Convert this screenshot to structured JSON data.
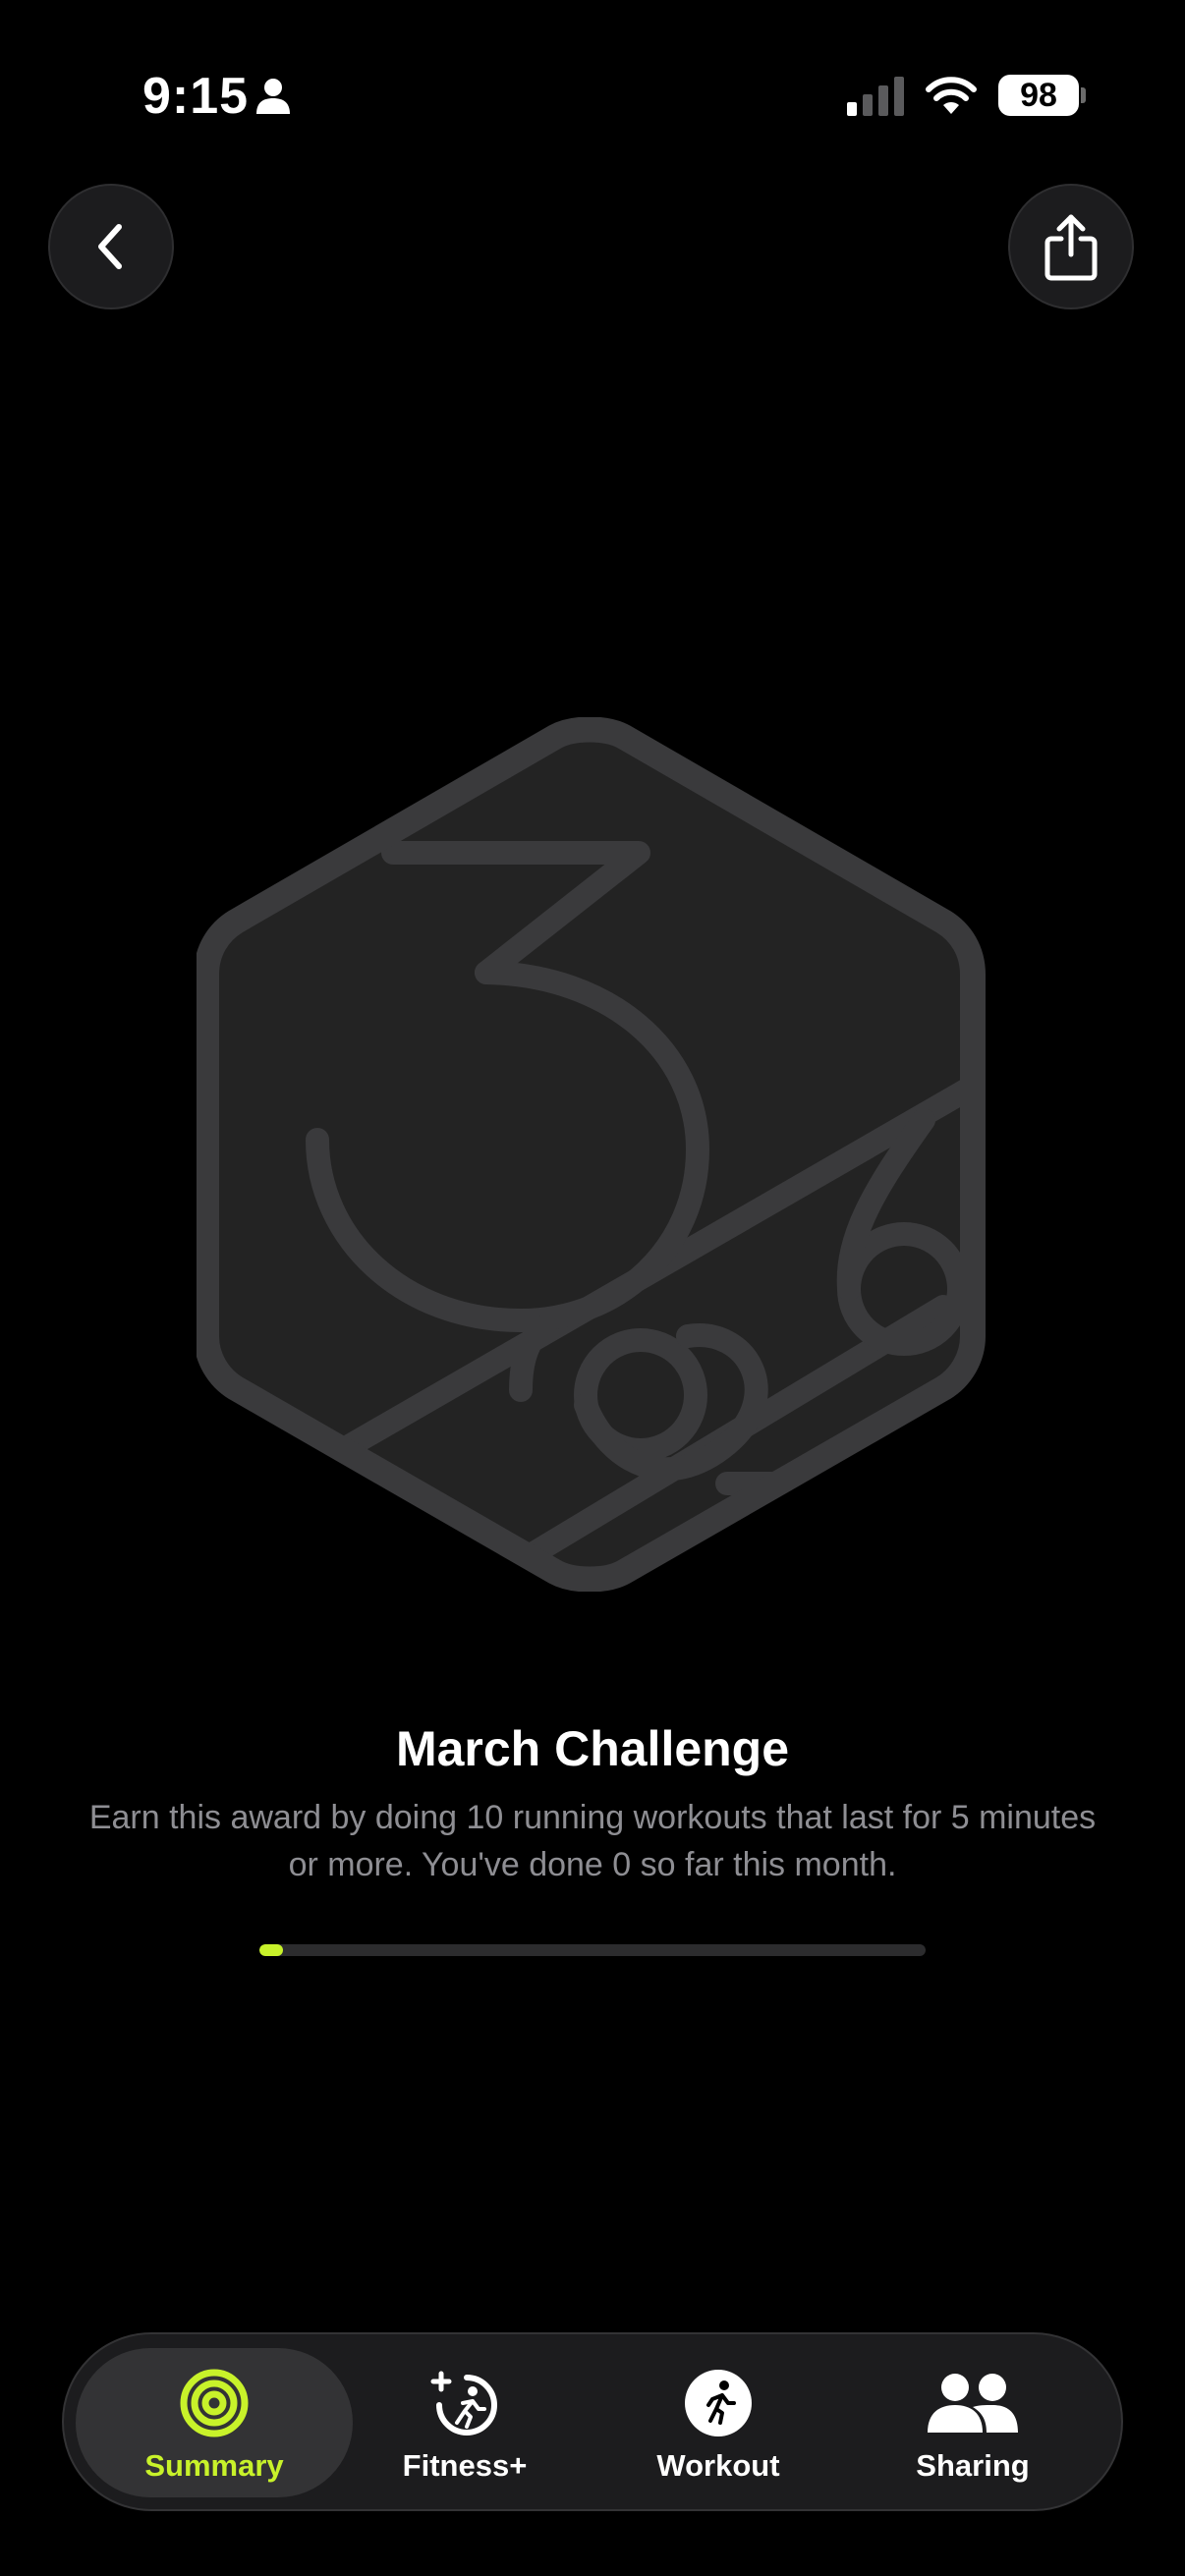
{
  "status_bar": {
    "time": "9:15",
    "battery": "98",
    "icons": [
      "person-icon",
      "cellular-signal-icon",
      "wifi-icon",
      "battery-icon"
    ]
  },
  "header": {
    "back_icon": "chevron-left-icon",
    "share_icon": "share-icon"
  },
  "award": {
    "badge_icon": "march-2026-hexagon-badge",
    "title": "March Challenge",
    "description": "Earn this award by doing 10 running workouts that last for 5 minutes or more. You've done 0 so far this month.",
    "progress_fraction": 0
  },
  "tab_bar": {
    "tabs": [
      {
        "label": "Summary",
        "icon": "activity-rings-icon",
        "active": true
      },
      {
        "label": "Fitness+",
        "icon": "fitness-plus-icon",
        "active": false
      },
      {
        "label": "Workout",
        "icon": "running-figure-icon",
        "active": false
      },
      {
        "label": "Sharing",
        "icon": "people-icon",
        "active": false
      }
    ]
  },
  "colors": {
    "accent": "#c8f22a",
    "background": "#000000",
    "surface": "#1c1c1e",
    "badge_stroke": "#3a3a3c",
    "badge_fill": "#232323",
    "secondary_text": "#8e8e93"
  }
}
